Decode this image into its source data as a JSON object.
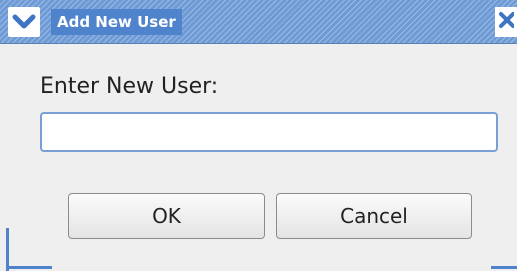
{
  "window": {
    "title": "Add New User",
    "menu_icon": "chevron-down-icon",
    "close_icon": "close-icon",
    "accent_color": "#4f83cc"
  },
  "dialog": {
    "prompt_label": "Enter New User:",
    "input_value": "",
    "ok_label": "OK",
    "cancel_label": "Cancel"
  }
}
